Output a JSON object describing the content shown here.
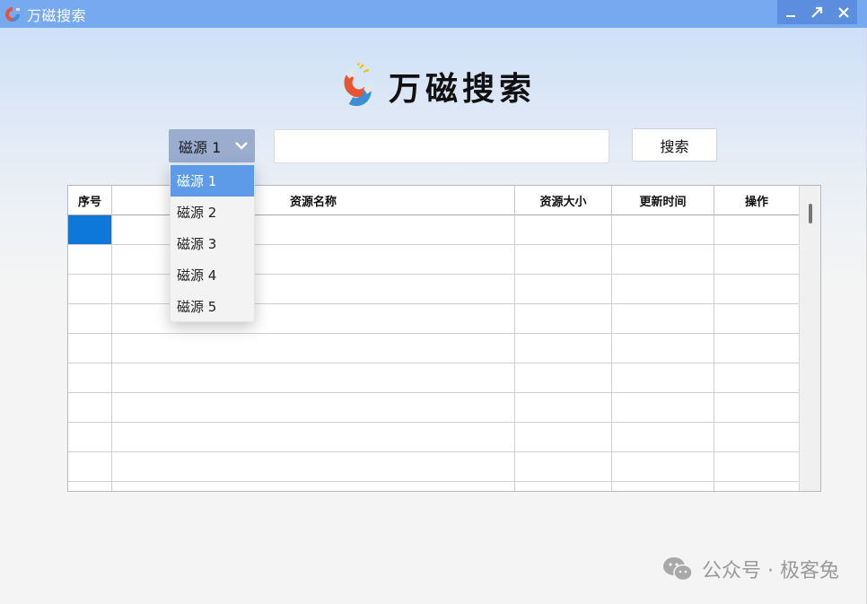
{
  "window": {
    "title": "万磁搜索",
    "controls": {
      "minimize": "‗",
      "maximize": "↗",
      "close": "✕"
    }
  },
  "logo": {
    "text": "万磁搜索",
    "icon": "magnet-icon"
  },
  "search": {
    "selected_source": "磁源 1",
    "placeholder": "",
    "value": "",
    "button_label": "搜索"
  },
  "dropdown": {
    "options": [
      "磁源 1",
      "磁源 2",
      "磁源 3",
      "磁源 4",
      "磁源 5"
    ],
    "active_index": 0
  },
  "table": {
    "columns": [
      "序号",
      "资源名称",
      "资源大小",
      "更新时间",
      "操作"
    ],
    "rows": 10
  },
  "watermark": {
    "text": "公众号 · 极客兔",
    "icon": "wechat-icon"
  },
  "colors": {
    "titlebar": "#76a9f0",
    "select_bg": "#9aadcf",
    "dropdown_active": "#5d9ae8",
    "selected_cell": "#0e78d8"
  }
}
